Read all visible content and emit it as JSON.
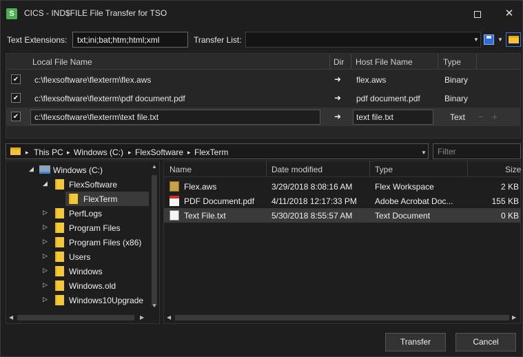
{
  "window": {
    "app_icon": "S",
    "title": "CICS - IND$FILE File Transfer for TSO",
    "maximize_icon": "maximize-icon",
    "close_glyph": "✕"
  },
  "options": {
    "text_ext_label": "Text Extensions:",
    "text_ext_value": "txt;ini;bat;htm;html;xml",
    "transfer_list_label": "Transfer List:",
    "transfer_list_value": ""
  },
  "transfer_table": {
    "headers": {
      "local": "Local File Name",
      "dir": "Dir",
      "host": "Host File Name",
      "type": "Type"
    },
    "rows": [
      {
        "checked": "✔",
        "local": "c:\\flexsoftware\\flexterm\\flex.aws",
        "dir": "➜",
        "host": "flex.aws",
        "type": "Binary"
      },
      {
        "checked": "✔",
        "local": "c:\\flexsoftware\\flexterm\\pdf document.pdf",
        "dir": "➜",
        "host": "pdf document.pdf",
        "type": "Binary"
      },
      {
        "checked": "✔",
        "local": "c:\\flexsoftware\\flexterm\\text file.txt",
        "dir": "➜",
        "host": "text file.txt",
        "type": "Text"
      }
    ],
    "minus": "−",
    "plus": "+"
  },
  "path_bar": {
    "crumbs": [
      "This PC",
      "Windows (C:)",
      "FlexSoftware",
      "FlexTerm"
    ],
    "sep": "▸",
    "filter_placeholder": "Filter"
  },
  "tree": {
    "nodes": [
      {
        "label": "Windows (C:)",
        "expander": "◢"
      },
      {
        "label": "FlexSoftware",
        "expander": "◢"
      },
      {
        "label": "FlexTerm",
        "expander": ""
      },
      {
        "label": "PerfLogs",
        "expander": "▷"
      },
      {
        "label": "Program Files",
        "expander": "▷"
      },
      {
        "label": "Program Files (x86)",
        "expander": "▷"
      },
      {
        "label": "Users",
        "expander": "▷"
      },
      {
        "label": "Windows",
        "expander": "▷"
      },
      {
        "label": "Windows.old",
        "expander": "▷"
      },
      {
        "label": "Windows10Upgrade",
        "expander": "▷"
      }
    ]
  },
  "file_list": {
    "headers": {
      "name": "Name",
      "modified": "Date modified",
      "type": "Type",
      "size": "Size"
    },
    "rows": [
      {
        "name": "Flex.aws",
        "modified": "3/29/2018 8:08:16 AM",
        "type": "Flex Workspace",
        "size": "2 KB",
        "icon": "aws-file-icon"
      },
      {
        "name": "PDF Document.pdf",
        "modified": "4/11/2018 12:17:33 PM",
        "type": "Adobe Acrobat Doc...",
        "size": "155 KB",
        "icon": "pdf-file-icon"
      },
      {
        "name": "Text File.txt",
        "modified": "5/30/2018 8:55:57 AM",
        "type": "Text Document",
        "size": "0 KB",
        "icon": "text-file-icon"
      }
    ]
  },
  "buttons": {
    "transfer": "Transfer",
    "cancel": "Cancel"
  }
}
